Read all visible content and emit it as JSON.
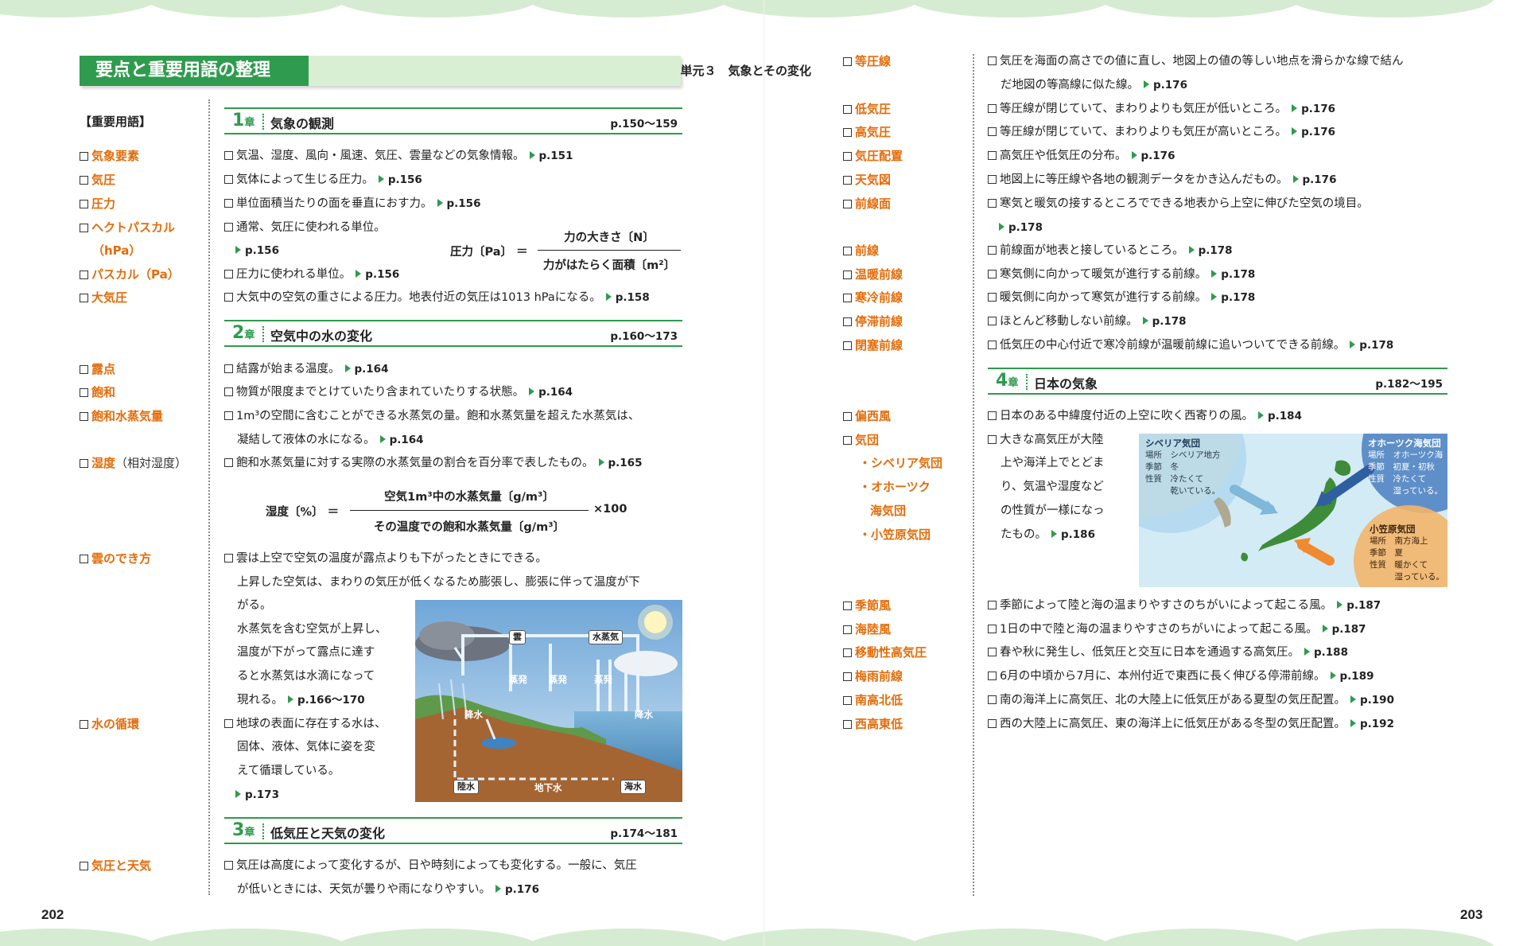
{
  "header": {
    "title": "要点と重要用語の整理",
    "unit": "単元３　気象とその変化"
  },
  "page_numbers": {
    "left": "202",
    "right": "203"
  },
  "terms_heading": "【重要用語】",
  "left_terms": [
    {
      "label": "気象要素"
    },
    {
      "label": "気圧"
    },
    {
      "label": "圧力"
    },
    {
      "label": "ヘクトパスカル"
    },
    {
      "label": "（hPa）"
    },
    {
      "label": "パスカル（Pa）"
    },
    {
      "label": "大気圧"
    },
    {
      "label": "露点"
    },
    {
      "label": "飽和"
    },
    {
      "label": "飽和水蒸気量"
    },
    {
      "label": "湿度",
      "extra": "（相対湿度）"
    },
    {
      "label": "雲のでき方"
    },
    {
      "label": "水の循環"
    },
    {
      "label": "気圧と天気"
    }
  ],
  "chapters": [
    {
      "num": "1",
      "suffix": "章",
      "title": "気象の観測",
      "pages": "p.150〜159"
    },
    {
      "num": "2",
      "suffix": "章",
      "title": "空気中の水の変化",
      "pages": "p.160〜173"
    },
    {
      "num": "3",
      "suffix": "章",
      "title": "低気圧と天気の変化",
      "pages": "p.174〜181"
    },
    {
      "num": "4",
      "suffix": "章",
      "title": "日本の気象",
      "pages": "p.182〜195"
    }
  ],
  "left_desc": [
    {
      "text": "気温、湿度、風向・風速、気圧、雲量などの気象情報。",
      "ref": "p.151",
      "box": true
    },
    {
      "text": "気体によって生じる圧力。",
      "ref": "p.156",
      "box": true
    },
    {
      "text": "単位面積当たりの面を垂直におす力。",
      "ref": "p.156",
      "box": true
    },
    {
      "text": "通常、気圧に使われる単位。",
      "ref": "",
      "box": true
    },
    {
      "text": "",
      "ref": "p.156",
      "box": false
    },
    {
      "text": "圧力に使われる単位。",
      "ref": "p.156",
      "box": true
    },
    {
      "text": "大気中の空気の重さによる圧力。地表付近の気圧は1013 hPaになる。",
      "ref": "p.158",
      "box": true
    },
    {
      "text": "結露が始まる温度。",
      "ref": "p.164",
      "box": true
    },
    {
      "text": "物質が限度までとけていたり含まれていたりする状態。",
      "ref": "p.164",
      "box": true
    },
    {
      "text": "1m³の空間に含むことができる水蒸気の量。飽和水蒸気量を超えた水蒸気は、",
      "ref": "",
      "box": true
    },
    {
      "text": "凝結して液体の水になる。",
      "ref": "p.164",
      "box": false
    },
    {
      "text": "飽和水蒸気量に対する実際の水蒸気量の割合を百分率で表したもの。",
      "ref": "p.165",
      "box": true
    },
    {
      "text": "雲は上空で空気の温度が露点よりも下がったときにできる。",
      "ref": "",
      "box": true
    },
    {
      "text": "上昇した空気は、まわりの気圧が低くなるため膨張し、膨張に伴って温度が下",
      "ref": "",
      "box": false
    },
    {
      "text": "がる。",
      "ref": "",
      "box": false
    },
    {
      "text": "水蒸気を含む空気が上昇し、",
      "ref": "",
      "box": false
    },
    {
      "text": "温度が下がって露点に達す",
      "ref": "",
      "box": false
    },
    {
      "text": "ると水蒸気は水滴になって",
      "ref": "",
      "box": false
    },
    {
      "text": "現れる。",
      "ref": "p.166〜170",
      "box": false
    },
    {
      "text": "地球の表面に存在する水は、",
      "ref": "",
      "box": true
    },
    {
      "text": "固体、液体、気体に姿を変",
      "ref": "",
      "box": false
    },
    {
      "text": "えて循環している。",
      "ref": "",
      "box": false
    },
    {
      "text": "",
      "ref": "p.173",
      "box": false
    },
    {
      "text": "気圧は高度によって変化するが、日や時刻によっても変化する。一般に、気圧",
      "ref": "",
      "box": true
    },
    {
      "text": "が低いときには、天気が曇りや雨になりやすい。",
      "ref": "p.176",
      "box": false
    }
  ],
  "formulas": {
    "pressure": {
      "lhs": "圧力〔Pa〕 ＝",
      "num": "力の大きさ〔N〕",
      "den": "力がはたらく面積〔m²〕"
    },
    "humidity": {
      "lhs": "湿度〔%〕 ＝",
      "num": "空気1m³中の水蒸気量〔g/m³〕",
      "den": "その温度での飽和水蒸気量〔g/m³〕",
      "rhs": "×100"
    }
  },
  "water_cycle_figure": {
    "labels": {
      "cloud": "雲",
      "vapor": "水蒸気",
      "evap1": "蒸発",
      "evap2": "蒸発",
      "evap3": "蒸発",
      "rain1": "降水",
      "rain2": "降水",
      "land_water": "陸水",
      "groundwater": "地下水",
      "sea_water": "海水"
    }
  },
  "right_terms": [
    {
      "label": "等圧線"
    },
    {
      "label": "低気圧"
    },
    {
      "label": "高気圧"
    },
    {
      "label": "気圧配置"
    },
    {
      "label": "天気図"
    },
    {
      "label": "前線面"
    },
    {
      "label": "前線"
    },
    {
      "label": "温暖前線"
    },
    {
      "label": "寒冷前線"
    },
    {
      "label": "停滞前線"
    },
    {
      "label": "閉塞前線"
    },
    {
      "label": "偏西風"
    },
    {
      "label": "気団"
    },
    {
      "label": "・シベリア気団"
    },
    {
      "label": "・オホーツク"
    },
    {
      "label": "海気団"
    },
    {
      "label": "・小笠原気団"
    },
    {
      "label": "季節風"
    },
    {
      "label": "海陸風"
    },
    {
      "label": "移動性高気圧"
    },
    {
      "label": "梅雨前線"
    },
    {
      "label": "南高北低"
    },
    {
      "label": "西高東低"
    }
  ],
  "right_desc": [
    {
      "text": "気圧を海面の高さでの値に直し、地図上の値の等しい地点を滑らかな線で結ん",
      "ref": "",
      "box": true
    },
    {
      "text": "だ地図の等高線に似た線。",
      "ref": "p.176",
      "box": false
    },
    {
      "text": "等圧線が閉じていて、まわりよりも気圧が低いところ。",
      "ref": "p.176",
      "box": true
    },
    {
      "text": "等圧線が閉じていて、まわりよりも気圧が高いところ。",
      "ref": "p.176",
      "box": true
    },
    {
      "text": "高気圧や低気圧の分布。",
      "ref": "p.176",
      "box": true
    },
    {
      "text": "地図上に等圧線や各地の観測データをかき込んだもの。",
      "ref": "p.176",
      "box": true
    },
    {
      "text": "寒気と暖気の接するところでできる地表から上空に伸びた空気の境目。",
      "ref": "",
      "box": true
    },
    {
      "text": "",
      "ref": "p.178",
      "box": false
    },
    {
      "text": "前線面が地表と接しているところ。",
      "ref": "p.178",
      "box": true
    },
    {
      "text": "寒気側に向かって暖気が進行する前線。",
      "ref": "p.178",
      "box": true
    },
    {
      "text": "暖気側に向かって寒気が進行する前線。",
      "ref": "p.178",
      "box": true
    },
    {
      "text": "ほとんど移動しない前線。",
      "ref": "p.178",
      "box": true
    },
    {
      "text": "低気圧の中心付近で寒冷前線が温暖前線に追いついてできる前線。",
      "ref": "p.178",
      "box": true
    },
    {
      "text": "日本のある中緯度付近の上空に吹く西寄りの風。",
      "ref": "p.184",
      "box": true
    },
    {
      "text": "大きな高気圧が大陸",
      "ref": "",
      "box": true
    },
    {
      "text": "上や海洋上でとどま",
      "ref": "",
      "box": false
    },
    {
      "text": "り、気温や湿度など",
      "ref": "",
      "box": false
    },
    {
      "text": "の性質が一様になっ",
      "ref": "",
      "box": false
    },
    {
      "text": "たもの。",
      "ref": "p.186",
      "box": false
    },
    {
      "text": "季節によって陸と海の温まりやすさのちがいによって起こる風。",
      "ref": "p.187",
      "box": true
    },
    {
      "text": "1日の中で陸と海の温まりやすさのちがいによって起こる風。",
      "ref": "p.187",
      "box": true
    },
    {
      "text": "春や秋に発生し、低気圧と交互に日本を通過する高気圧。",
      "ref": "p.188",
      "box": true
    },
    {
      "text": "6月の中頃から7月に、本州付近で東西に長く伸びる停滞前線。",
      "ref": "p.189",
      "box": true
    },
    {
      "text": "南の海洋上に高気圧、北の大陸上に低気圧がある夏型の気圧配置。",
      "ref": "p.190",
      "box": true
    },
    {
      "text": "西の大陸上に高気圧、東の海洋上に低気圧がある冬型の気圧配置。",
      "ref": "p.192",
      "box": true
    }
  ],
  "air_mass_map": {
    "siberia": {
      "title": "シベリア気団",
      "rows": [
        "場所　シベリア地方",
        "季節　冬",
        "性質　冷たくて",
        "　　　乾いている。"
      ],
      "color": "#7fb8d8"
    },
    "okhotsk": {
      "title": "オホーツク海気団",
      "rows": [
        "場所　オホーツク海",
        "季節　初夏・初秋",
        "性質　冷たくて",
        "　　　湿っている。"
      ],
      "color": "#4a7fc0"
    },
    "ogasawara": {
      "title": "小笠原気団",
      "rows": [
        "場所　南方海上",
        "季節　夏",
        "性質　暖かくて",
        "　　　湿っている。"
      ],
      "color": "#f0a04a"
    }
  },
  "colors": {
    "accent_green": "#2f9b4e",
    "term_orange": "#e36c09",
    "header_bg": "#d9efd3"
  }
}
